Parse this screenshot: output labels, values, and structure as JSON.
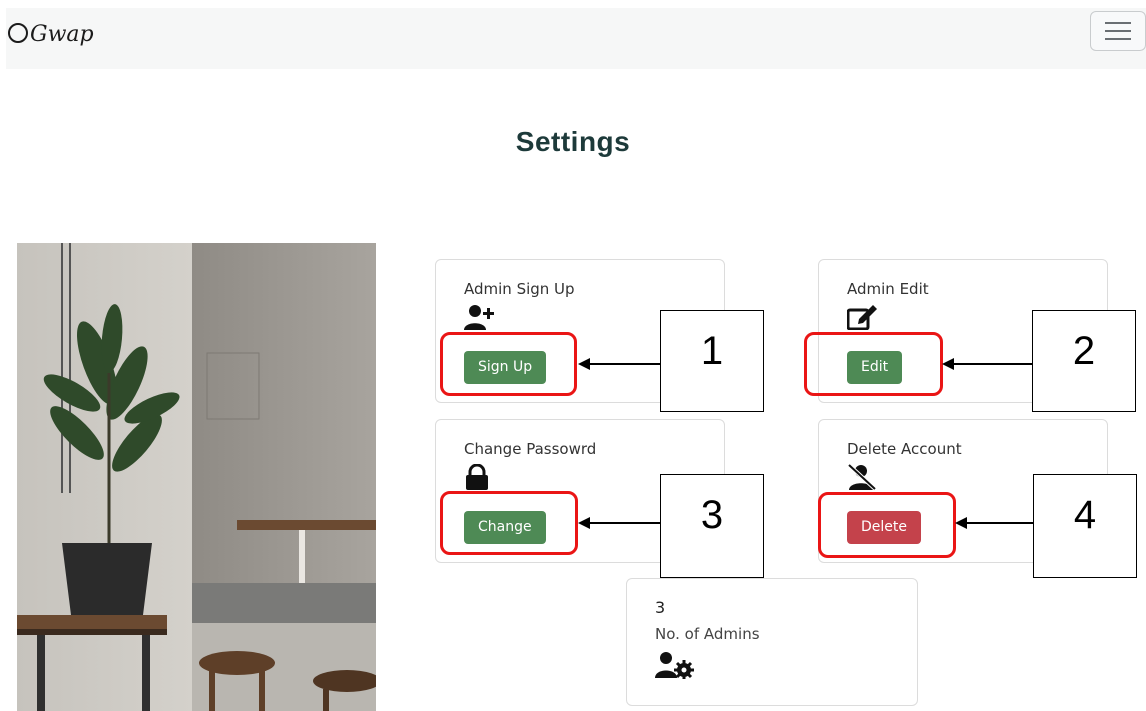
{
  "navbar": {
    "brand": "Gwap",
    "menu_icon": "hamburger-menu-icon"
  },
  "page": {
    "title": "Settings"
  },
  "cards": [
    {
      "label": "Admin Sign Up",
      "icon": "user-plus-icon",
      "button": "Sign Up",
      "button_color": "#4e8a55"
    },
    {
      "label": "Admin Edit",
      "icon": "pen-to-square-icon",
      "button": "Edit",
      "button_color": "#4e8a55"
    },
    {
      "label": "Change Passowrd",
      "icon": "lock-icon",
      "button": "Change",
      "button_color": "#4e8a55"
    },
    {
      "label": "Delete Account",
      "icon": "user-slash-icon",
      "button": "Delete",
      "button_color": "#c4424b"
    }
  ],
  "admins": {
    "count": "3",
    "label": "No. of Admins",
    "icon": "user-gear-icon"
  },
  "annotations": [
    "1",
    "2",
    "3",
    "4"
  ],
  "colors": {
    "highlight": "#ea1515",
    "green": "#4e8a55",
    "red": "#c4424b",
    "title": "#1d3a3a"
  }
}
